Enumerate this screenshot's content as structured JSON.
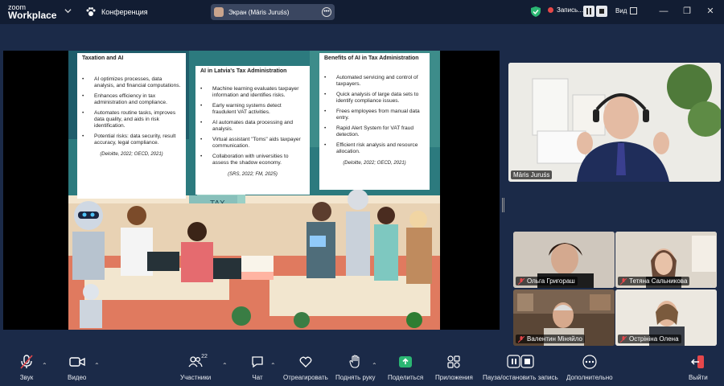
{
  "app": {
    "logo_small": "zoom",
    "logo_big": "Workplace"
  },
  "meeting": {
    "title": "Конференция"
  },
  "share": {
    "label": "Экран (Māris Juruśs)"
  },
  "recording": {
    "label": "Запись..."
  },
  "view": {
    "label": "Вид"
  },
  "slide": {
    "cards": [
      {
        "title": "Taxation and AI",
        "items": [
          "AI optimizes processes, data analysis, and financial computations.",
          "Enhances efficiency in tax administration and compliance.",
          "Automates routine tasks, improves data quality, and aids in risk identification.",
          "Potential risks: data security, result accuracy, legal compliance."
        ],
        "cite": "(Deloitte, 2022; OECD, 2021)"
      },
      {
        "title": "AI in Latvia's Tax Administration",
        "items": [
          "Machine learning evaluates taxpayer information and identifies risks.",
          "Early warning systems detect fraudulent VAT activities.",
          "AI automates data processing and analysis.",
          "Virtual assistant \"Toms\" aids taxpayer communication.",
          "Collaboration with universities to assess the shadow economy."
        ],
        "cite": "(SRS, 2022; FM, 2025)"
      },
      {
        "title": "Benefits of AI in Tax Administration",
        "items": [
          "Automated servicing and control of taxpayers.",
          "Quick analysis of large data sets to identify compliance issues.",
          "Frees employees from manual data entry.",
          "Rapid Alert System for VAT fraud detection.",
          "Efficient risk analysis and resource allocation."
        ],
        "cite": "(Deloitte, 2022; OECD, 2021)"
      }
    ],
    "sign_text": "TAX"
  },
  "participants_video": [
    {
      "name": "Māris Juruśs"
    },
    {
      "name": "Ольга Григораш"
    },
    {
      "name": "Тетяна Сальникова"
    },
    {
      "name": "Валентин Міняйло"
    },
    {
      "name": "Острініна Олена"
    }
  ],
  "toolbar": {
    "audio": "Звук",
    "video": "Видео",
    "participants": "Участники",
    "participants_count": "22",
    "chat": "Чат",
    "react": "Отреагировать",
    "raise_hand": "Поднять руку",
    "share": "Поделиться",
    "apps": "Приложения",
    "pause_record": "Пауза/остановить запись",
    "more": "Дополнительно",
    "leave": "Выйти"
  },
  "colors": {
    "accent_green": "#2bb673",
    "leave_red": "#e5474b",
    "bg": "#1b2a48"
  }
}
